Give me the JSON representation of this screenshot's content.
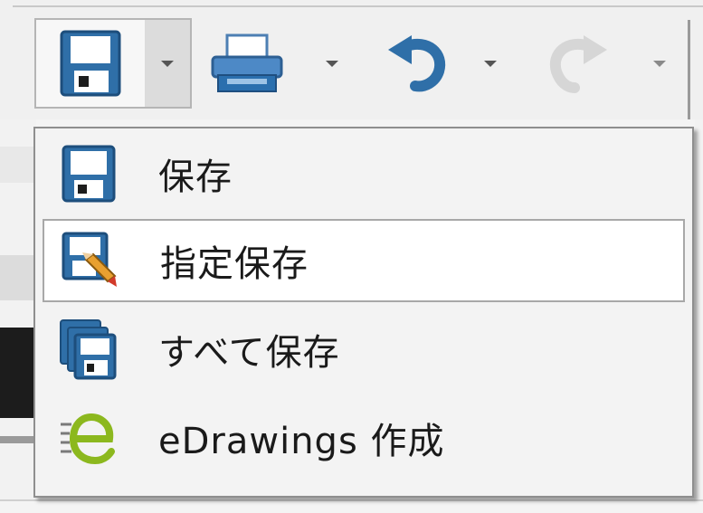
{
  "toolbar": {
    "buttons": [
      {
        "icon": "floppy-disk-icon",
        "has_dropdown": true,
        "state": "pressed"
      },
      {
        "icon": "printer-icon",
        "has_dropdown": true,
        "state": "normal"
      },
      {
        "icon": "undo-icon",
        "has_dropdown": true,
        "state": "normal"
      },
      {
        "icon": "redo-icon",
        "has_dropdown": true,
        "state": "disabled"
      }
    ]
  },
  "menu": {
    "items": [
      {
        "label": "保存",
        "icon": "save-icon"
      },
      {
        "label": "指定保存",
        "icon": "save-as-icon",
        "highlighted": true
      },
      {
        "label": "すべて保存",
        "icon": "save-all-icon"
      },
      {
        "label": "eDrawings 作成",
        "icon": "edrawings-icon"
      }
    ]
  },
  "colors": {
    "accent_blue": "#2f6fa8",
    "menu_bg": "#f3f3f3",
    "highlight_bg": "#ffffff",
    "edrawings_green": "#8cb81e"
  }
}
